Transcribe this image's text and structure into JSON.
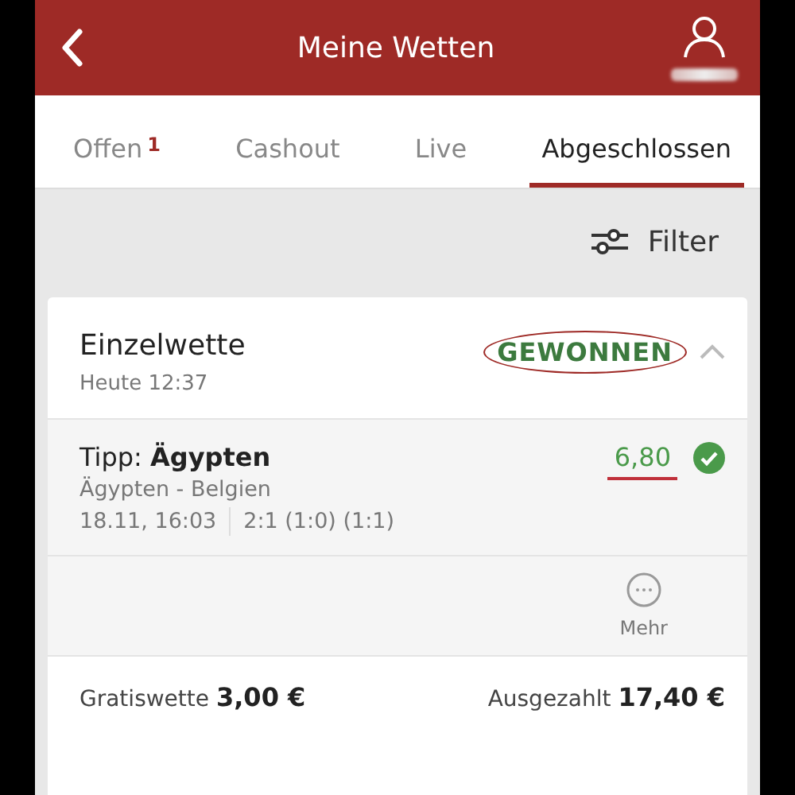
{
  "header": {
    "title": "Meine Wetten"
  },
  "tabs": [
    {
      "label": "Offen",
      "badge": "1",
      "selected": false
    },
    {
      "label": "Cashout",
      "selected": false
    },
    {
      "label": "Live",
      "selected": false
    },
    {
      "label": "Abgeschlossen",
      "selected": true
    }
  ],
  "filter": {
    "label": "Filter"
  },
  "bet": {
    "type": "Einzelwette",
    "time": "Heute 12:37",
    "status": "GEWONNEN",
    "expanded": true,
    "selection": "Tipp: **Ägypten**",
    "match": "Ägypten - Belgien",
    "date": "18.11, 16:03",
    "score": "2:1 (1:0) (1:1)",
    "odds": "6,80",
    "won": true,
    "more": "Mehr",
    "stake": "Gratiswette **3,00 €**",
    "payout": "Ausgezahlt **17,40 €**"
  }
}
